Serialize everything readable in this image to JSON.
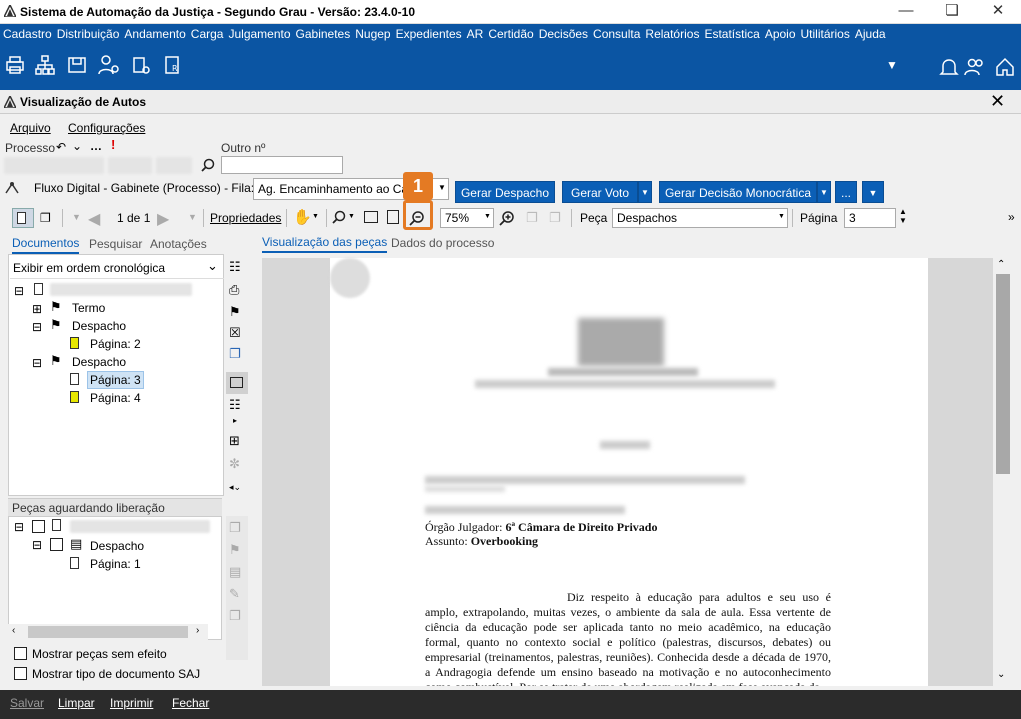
{
  "window": {
    "title": "Sistema de Automação da Justiça - Segundo Grau - Versão: 23.4.0-10"
  },
  "menu": [
    "Cadastro",
    "Distribuição",
    "Andamento",
    "Carga",
    "Julgamento",
    "Gabinetes",
    "Nugep",
    "Expedientes",
    "AR",
    "Certidão",
    "Decisões",
    "Consulta",
    "Relatórios",
    "Estatística",
    "Apoio",
    "Utilitários",
    "Ajuda"
  ],
  "subwindow": {
    "title": "Visualização de Autos"
  },
  "submenu": {
    "arquivo": "Arquivo",
    "configuracoes": "Configurações"
  },
  "processo": {
    "label": "Processo",
    "outro_label": "Outro nº"
  },
  "fluxo": {
    "label": "Fluxo Digital - Gabinete (Processo) - Fila:",
    "fila_value": "Ag. Encaminhamento ao Ca",
    "btn_despacho": "Gerar Despacho",
    "btn_voto": "Gerar Voto",
    "btn_decisao": "Gerar Decisão Monocrática",
    "btn_more": "..."
  },
  "viewer_toolbar": {
    "page_of": "1 de 1",
    "propriedades": "Propriedades",
    "zoom": "75%",
    "peca_label": "Peça",
    "peca_value": "Despachos",
    "pagina_label": "Página",
    "pagina_value": "3"
  },
  "left_tabs": [
    "Documentos",
    "Pesquisar",
    "Anotações"
  ],
  "order_select": "Exibir em ordem cronológica",
  "tree": {
    "termo": "Termo",
    "despacho1": "Despacho",
    "pagina2": "Página: 2",
    "despacho2": "Despacho",
    "pagina3": "Página: 3",
    "pagina4": "Página: 4"
  },
  "pecas_aguardando": {
    "title": "Peças aguardando liberação",
    "despacho": "Despacho",
    "pagina1": "Página: 1"
  },
  "checkboxes": {
    "sem_efeito": "Mostrar peças sem efeito",
    "tipo_doc": "Mostrar tipo de documento SAJ"
  },
  "right_tabs": [
    "Visualização das peças",
    "Dados do processo"
  ],
  "document": {
    "orgao_label": "Órgão Julgador:",
    "orgao_value": "6ª Câmara de Direito Privado",
    "assunto_label": "Assunto:",
    "assunto_value": "Overbooking",
    "paragraph": "Diz respeito à educação para adultos e seu uso é amplo, extrapolando, muitas vezes, o ambiente da sala de aula. Essa vertente de ciência da educação pode ser aplicada tanto no meio acadêmico, na educação formal, quanto no contexto social e político (palestras, discursos, debates) ou empresarial (treinamentos, palestras, reuniões). Conhecida desde a década de 1970, a Andragogia defende um ensino baseado na motivação e no autoconhecimento como combustível. Por se tratar de uma abordagem realizada em fase avançada da"
  },
  "bottom": {
    "salvar": "Salvar",
    "limpar": "Limpar",
    "imprimir": "Imprimir",
    "fechar": "Fechar"
  },
  "callout": "1"
}
